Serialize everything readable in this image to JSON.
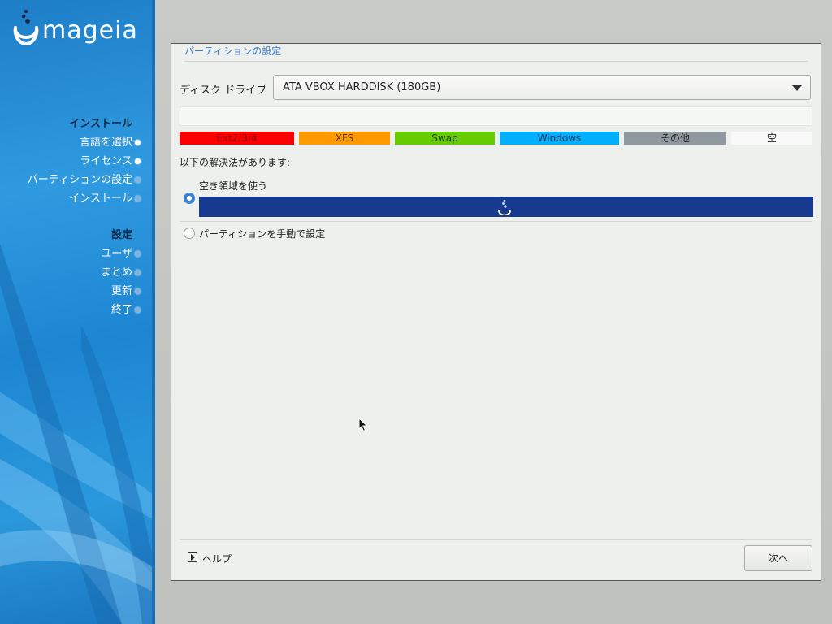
{
  "sidebar": {
    "logo_text": "mageia",
    "groups": [
      {
        "heading": "インストール",
        "items": [
          {
            "label": "言語を選択",
            "state": "done"
          },
          {
            "label": "ライセンス",
            "state": "done"
          },
          {
            "label": "パーティションの設定",
            "state": "current"
          },
          {
            "label": "インストール",
            "state": "pending"
          }
        ]
      },
      {
        "heading": "設定",
        "items": [
          {
            "label": "ユーザ",
            "state": "pending"
          },
          {
            "label": "まとめ",
            "state": "pending"
          },
          {
            "label": "更新",
            "state": "pending"
          },
          {
            "label": "終了",
            "state": "pending"
          }
        ]
      }
    ]
  },
  "dialog": {
    "title": "パーティションの設定",
    "disk_label": "ディスク ドライブ",
    "disk_value": "ATA VBOX HARDDISK (180GB)",
    "legend": [
      {
        "label": "Ext2/3/4",
        "color": "#ff0000",
        "text_color": "#8b0000"
      },
      {
        "label": "XFS",
        "color": "#ff9900",
        "text_color": "#5a3300"
      },
      {
        "label": "Swap",
        "color": "#66cc00",
        "text_color": "#1e3d00"
      },
      {
        "label": "Windows",
        "color": "#00b0ff",
        "text_color": "#003355"
      },
      {
        "label": "その他",
        "color": "#9099a0",
        "text_color": "#222222"
      },
      {
        "label": "空",
        "color": "#f8f9f8",
        "text_color": "#222222"
      }
    ],
    "solution_label": "以下の解決法があります:",
    "options": [
      {
        "label": "空き領域を使う",
        "checked": true
      },
      {
        "label": "パーティションを手動で設定",
        "checked": false
      }
    ],
    "usage_bar_color": "#17398f",
    "help_label": "ヘルプ",
    "next_label": "次へ"
  }
}
